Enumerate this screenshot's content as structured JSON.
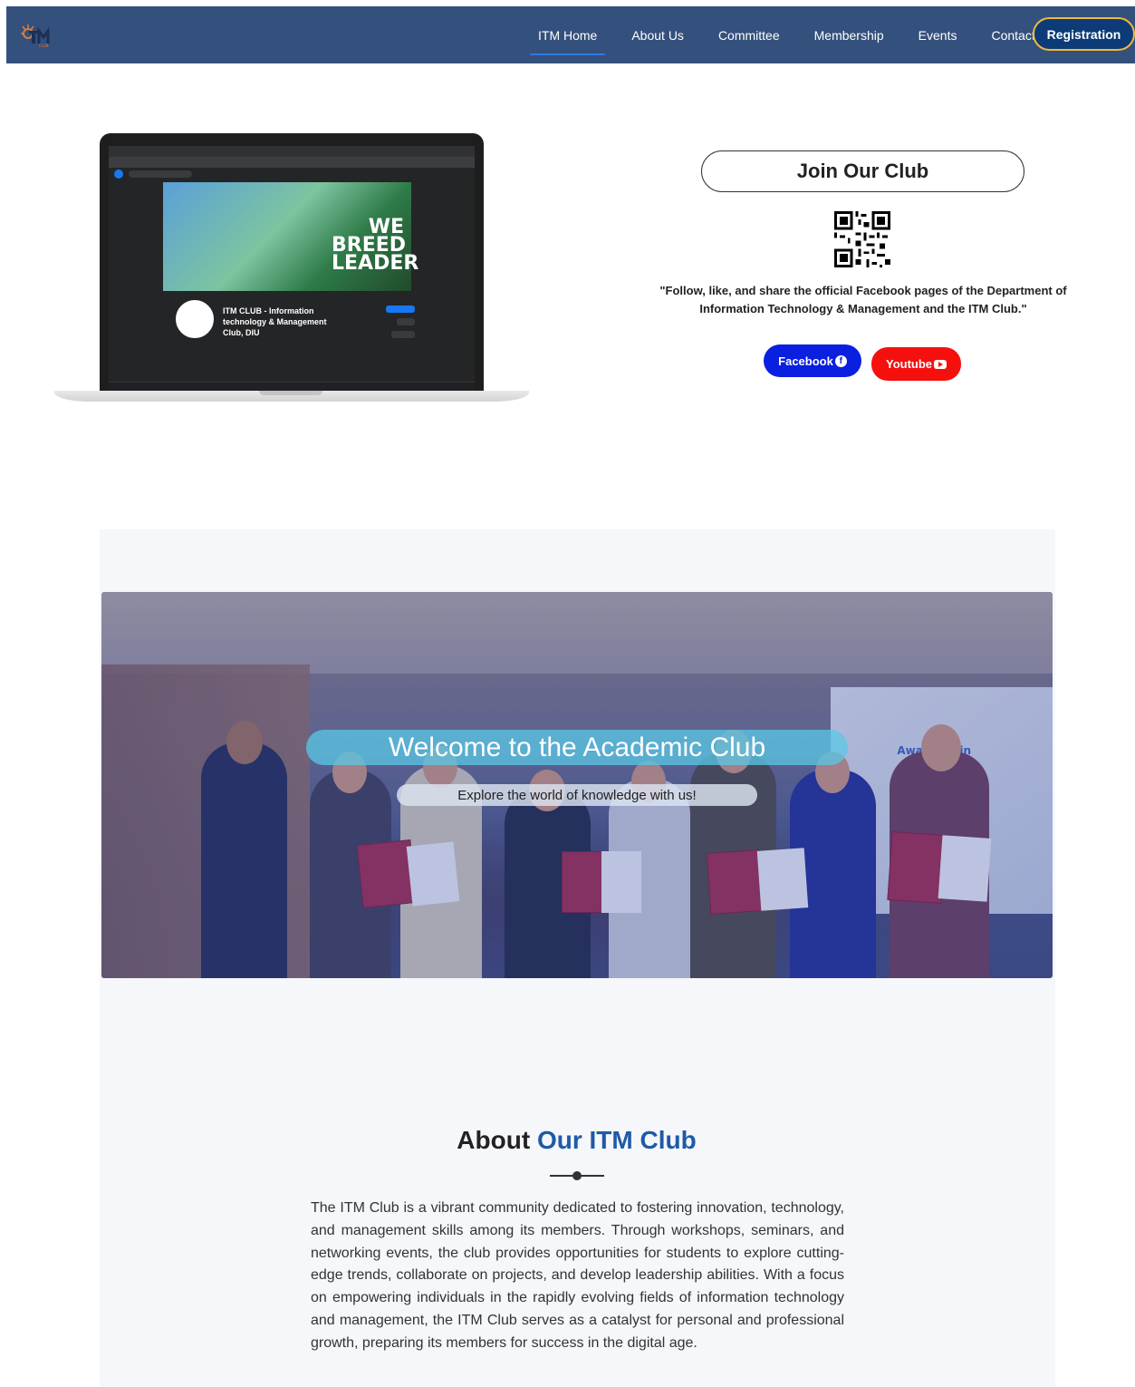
{
  "nav": {
    "logo_text": "ITM",
    "links": [
      "ITM Home",
      "About Us",
      "Committee",
      "Membership",
      "Events",
      "Contact"
    ],
    "active": "ITM Home",
    "register_label": "Registration"
  },
  "laptop": {
    "cover_text": "WE BREED LEADER",
    "page_name": "ITM CLUB - Information technology & Management Club, DIU"
  },
  "join": {
    "title": "Join Our Club",
    "text": "\"Follow, like, and share the official Facebook pages of the Department of Information Technology & Management and the ITM Club.\"",
    "facebook_label": "Facebook",
    "youtube_label": "Youtube",
    "colors": {
      "facebook": "#0a1fe0",
      "youtube": "#f5100e"
    }
  },
  "hero": {
    "title": "Welcome to the Academic Club",
    "subtitle": "Explore the world of knowledge with us!",
    "screen_text": "Award Givin"
  },
  "about": {
    "title_plain": "About ",
    "title_highlight": "Our ITM Club",
    "body": "The ITM Club is a vibrant community dedicated to fostering innovation, technology, and management skills among its members. Through workshops, seminars, and networking events, the club provides opportunities for students to explore cutting-edge trends, collaborate on projects, and develop leadership abilities. With a focus on empowering individuals in the rapidly evolving fields of information technology and management, the ITM Club serves as a catalyst for personal and professional growth, preparing its members for success in the digital age."
  },
  "theme": {
    "nav_bg": "#34507c",
    "accent": "#1f5aa8",
    "register_border": "#f0b83a"
  }
}
